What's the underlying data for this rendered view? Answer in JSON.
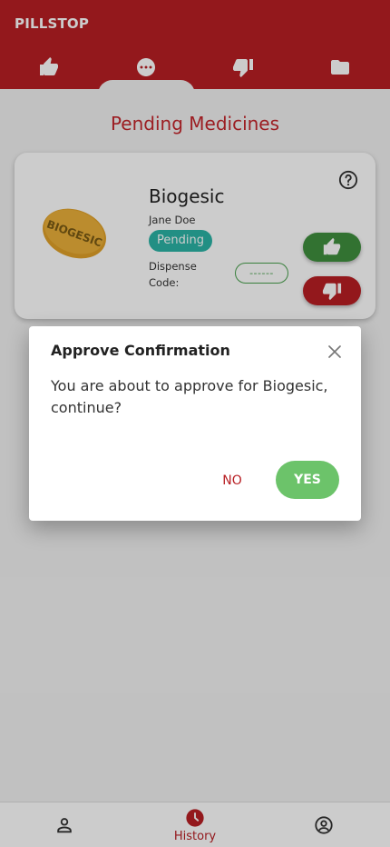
{
  "app": {
    "brand": "PILLSTOP"
  },
  "tabs": [
    {
      "icon": "thumbs-up-icon"
    },
    {
      "icon": "more-horizontal-circle-icon"
    },
    {
      "icon": "thumbs-down-icon"
    },
    {
      "icon": "folder-icon"
    }
  ],
  "page": {
    "title": "Pending Medicines"
  },
  "card": {
    "medicine": "Biogesic",
    "patient": "Jane Doe",
    "status": "Pending",
    "dispense_label": "Dispense Code:",
    "dispense_code": "------",
    "pill_text": "BIOGESIC"
  },
  "dialog": {
    "title": "Approve Confirmation",
    "body": "You are about to approve for Biogesic, continue?",
    "no_label": "NO",
    "yes_label": "YES"
  },
  "bottom_nav": [
    {
      "icon": "person-icon",
      "label": ""
    },
    {
      "icon": "clock-icon",
      "label": "History"
    },
    {
      "icon": "account-circle-icon",
      "label": ""
    }
  ],
  "colors": {
    "primary": "#b81f24",
    "accent_green": "#3f8f3e",
    "yes_green": "#6cc36a",
    "status_teal": "#2bb3a6"
  }
}
